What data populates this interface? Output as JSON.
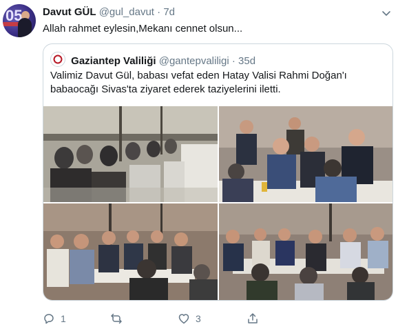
{
  "tweet": {
    "author_name": "Davut GÜL",
    "author_handle": "@gul_davut",
    "separator": " · ",
    "time": "7d",
    "text": "Allah rahmet eylesin,Mekanı cennet olsun..."
  },
  "quoted": {
    "author_name": "Gaziantep Valiliği",
    "author_handle": "@gantepvaliligi",
    "separator": " · ",
    "time": "35d",
    "text_line1": "Valimiz Davut Gül, babası vefat eden Hatay Valisi Rahmi Doğan'ı",
    "text_line2": "babaocağı Sivas'ta ziyaret ederek taziyelerini iletti."
  },
  "actions": {
    "reply_count": "1",
    "retweet_count": "",
    "like_count": "3"
  },
  "colors": {
    "text": "#14171a",
    "muted": "#657786",
    "border": "#ccd6dd"
  }
}
